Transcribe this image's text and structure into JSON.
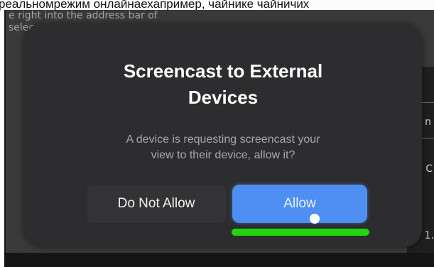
{
  "page_strip": {
    "text": "реальномрежим онлайнаехапример, чайнике чайничих"
  },
  "background": {
    "text_line_1": "e right into the address bar of",
    "text_line_2": "selec",
    "right_fragment_1": "C",
    "right_fragment_2": "1.",
    "right_fragment_3": "n"
  },
  "dialog": {
    "title_line_1": "Screencast to External",
    "title_line_2": "Devices",
    "message_line_1": "A device is requesting screencast your",
    "message_line_2": "view to their device, allow it?",
    "deny_label": "Do Not Allow",
    "allow_label": "Allow"
  },
  "colors": {
    "dialog_bg": "#2d2d2f",
    "allow_accent": "#4f8ef2",
    "focus_indicator": "#1fd60f"
  }
}
